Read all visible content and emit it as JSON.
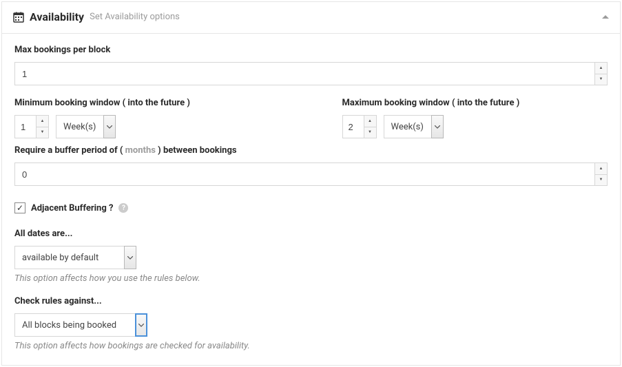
{
  "header": {
    "title": "Availability",
    "subtitle": "Set Availability options"
  },
  "fields": {
    "max_bookings_label": "Max bookings per block",
    "max_bookings_value": "1",
    "min_window_label": "Minimum booking window ( into the future )",
    "min_window_value": "1",
    "min_window_unit": "Week(s)",
    "max_window_label": "Maximum booking window ( into the future )",
    "max_window_value": "2",
    "max_window_unit": "Week(s)",
    "buffer_label_pre": "Require a buffer period of (",
    "buffer_label_unit": "months",
    "buffer_label_post": ") between bookings",
    "buffer_value": "0",
    "adjacent_label": "Adjacent Buffering ?",
    "all_dates_label": "All dates are...",
    "all_dates_value": "available by default",
    "all_dates_hint": "This option affects how you use the rules below.",
    "check_rules_label": "Check rules against...",
    "check_rules_value": "All blocks being booked",
    "check_rules_hint": "This option affects how bookings are checked for availability."
  }
}
